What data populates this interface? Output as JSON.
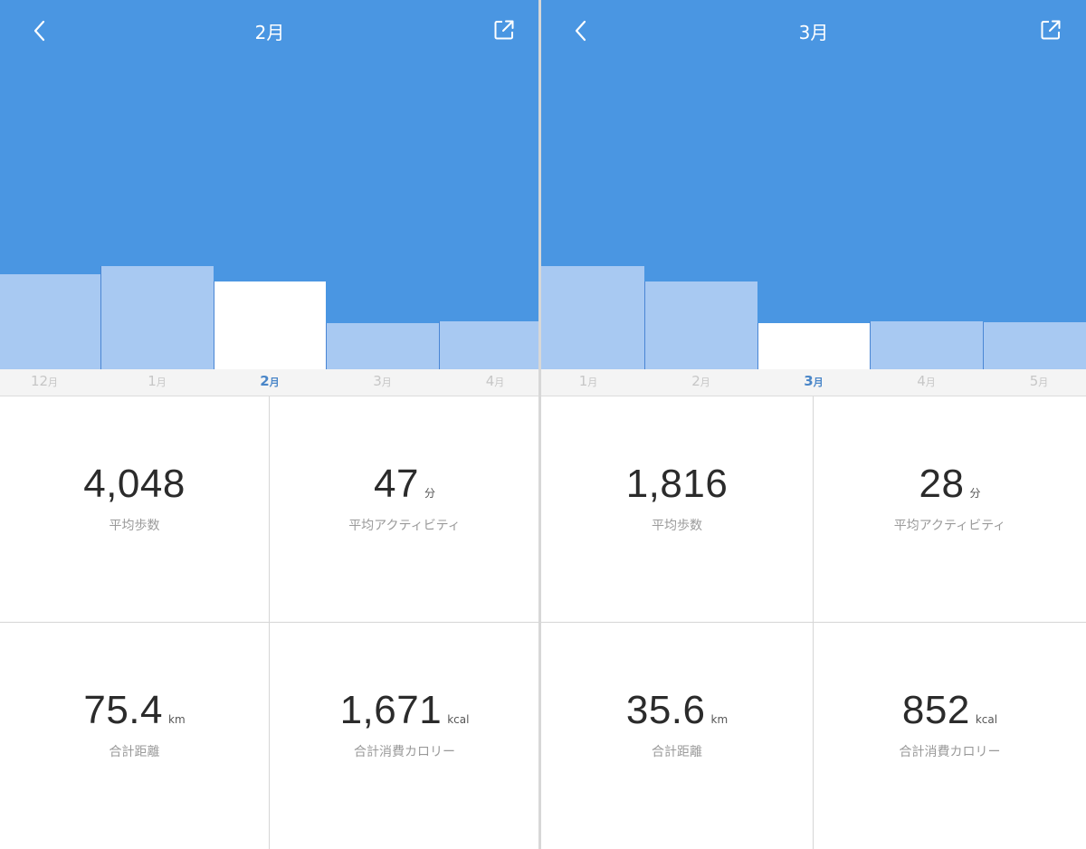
{
  "colors": {
    "accent": "#4a96e2",
    "bar": "#a8c9f2",
    "selected_bar": "#ffffff",
    "selected_month": "#4a86c8"
  },
  "panels": [
    {
      "title": "2月",
      "icons": {
        "back": "chevron-left-icon",
        "share": "share-export-icon"
      },
      "months": [
        {
          "num": "12",
          "unit": "月",
          "steps": 3100
        },
        {
          "num": "1",
          "unit": "月",
          "steps": 3350
        },
        {
          "num": "2",
          "unit": "月",
          "steps": 2850,
          "selected": true
        },
        {
          "num": "3",
          "unit": "月",
          "steps": 1500
        },
        {
          "num": "4",
          "unit": "月",
          "steps": 1560
        }
      ],
      "stats": {
        "avg_steps": {
          "value": "4,048",
          "unit": "",
          "label": "平均歩数"
        },
        "avg_activity": {
          "value": "47",
          "unit": "分",
          "label": "平均アクティビティ"
        },
        "total_distance": {
          "value": "75.4",
          "unit": "km",
          "label": "合計距離"
        },
        "total_calories": {
          "value": "1,671",
          "unit": "kcal",
          "label": "合計消費カロリー"
        }
      }
    },
    {
      "title": "3月",
      "icons": {
        "back": "chevron-left-icon",
        "share": "share-export-icon"
      },
      "months": [
        {
          "num": "1",
          "unit": "月",
          "steps": 3350
        },
        {
          "num": "2",
          "unit": "月",
          "steps": 2850
        },
        {
          "num": "3",
          "unit": "月",
          "steps": 1500,
          "selected": true
        },
        {
          "num": "4",
          "unit": "月",
          "steps": 1560
        },
        {
          "num": "5",
          "unit": "月",
          "steps": 1540
        }
      ],
      "stats": {
        "avg_steps": {
          "value": "1,816",
          "unit": "",
          "label": "平均歩数"
        },
        "avg_activity": {
          "value": "28",
          "unit": "分",
          "label": "平均アクティビティ"
        },
        "total_distance": {
          "value": "35.6",
          "unit": "km",
          "label": "合計距離"
        },
        "total_calories": {
          "value": "852",
          "unit": "kcal",
          "label": "合計消費カロリー"
        }
      }
    }
  ]
}
